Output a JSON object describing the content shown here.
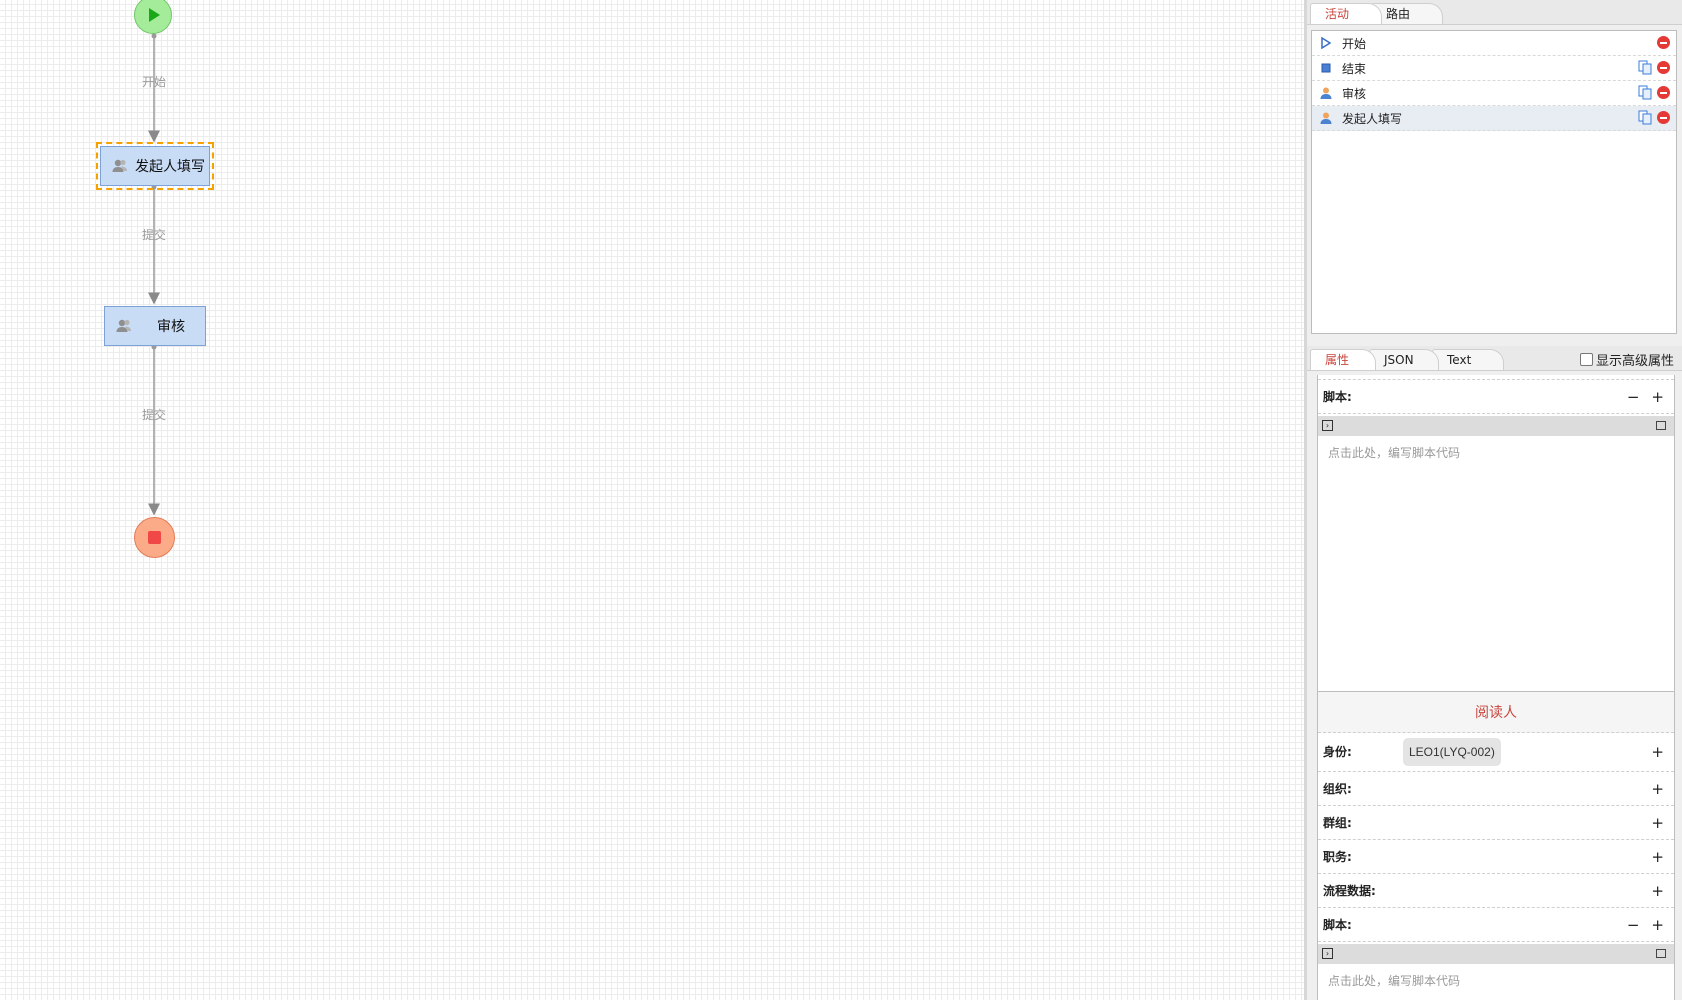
{
  "canvas": {
    "start_node": "start-node",
    "end_node": "end-node",
    "tasks": {
      "fill": {
        "label": "发起人填写"
      },
      "audit": {
        "label": "审核"
      }
    },
    "routes": {
      "start": "开始",
      "submit1": "提交",
      "submit2": "提交"
    }
  },
  "panel": {
    "top_tabs": {
      "activity": "活动",
      "route": "路由"
    },
    "activities": [
      {
        "label": "开始",
        "icon": "start-triangle-icon"
      },
      {
        "label": "结束",
        "icon": "end-square-icon"
      },
      {
        "label": "审核",
        "icon": "user-icon"
      },
      {
        "label": "发起人填写",
        "icon": "user-icon",
        "selected": true
      }
    ],
    "prop_tabs": {
      "props": "属性",
      "json": "JSON",
      "text": "Text"
    },
    "advanced_toggle": "显示高级属性",
    "props": {
      "script1_label": "脚本:",
      "script1_placeholder": "点击此处，编写脚本代码",
      "reader_section": "阅读人",
      "identity_label": "身份:",
      "identity_value": "LEO1(LYQ-002)",
      "org_label": "组织:",
      "group_label": "群组:",
      "duty_label": "职务:",
      "flowdata_label": "流程数据:",
      "script2_label": "脚本:",
      "script2_placeholder": "点击此处，编写脚本代码"
    }
  },
  "colors": {
    "accent_red": "#c9453d",
    "task_fill": "#c9dcf6",
    "start_green": "#a4ec9a",
    "end_orange": "#fbab88"
  }
}
